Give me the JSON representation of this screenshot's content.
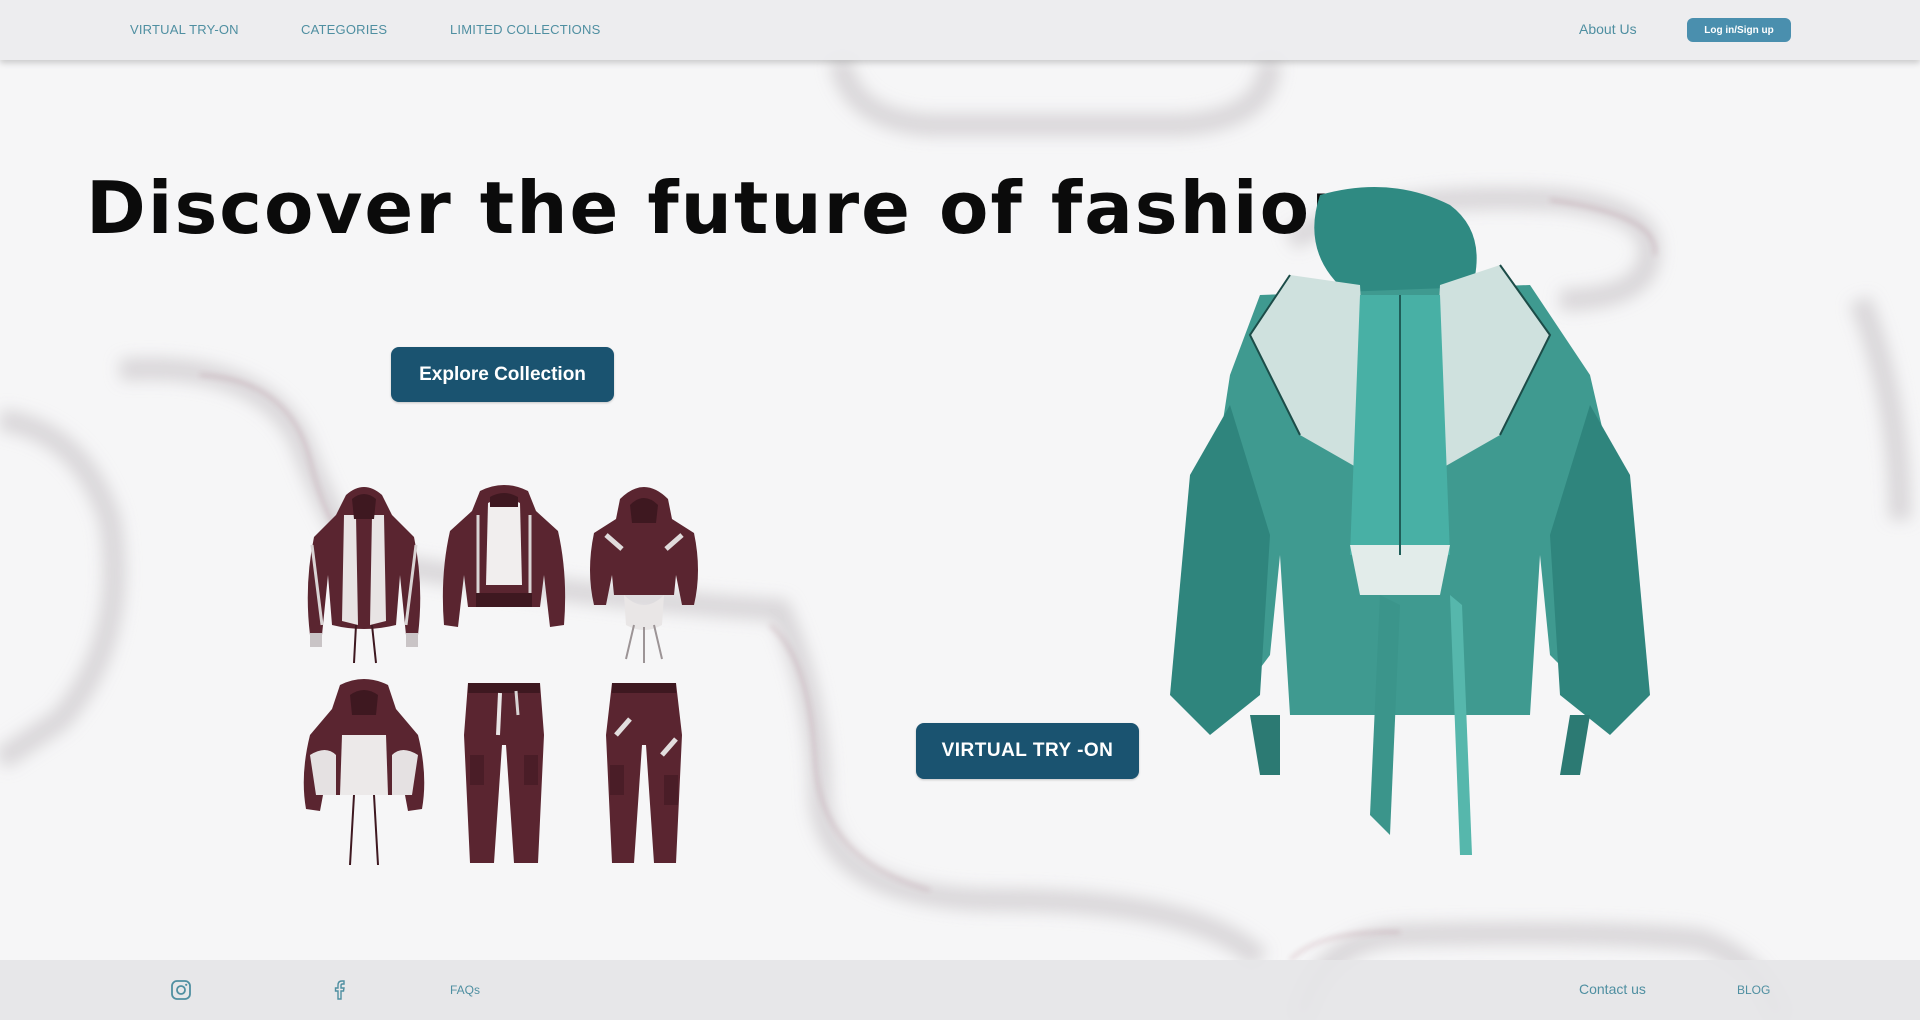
{
  "nav": {
    "left_links": [
      "VIRTUAL TRY-ON",
      "CATEGORIES",
      "LIMITED COLLECTIONS"
    ],
    "about": "About Us",
    "login": "Log in/Sign up"
  },
  "hero": {
    "title": "Discover the future of fashion",
    "explore_button": "Explore Collection",
    "tryon_button": "VIRTUAL TRY -ON"
  },
  "products": [
    {
      "icon": "maroon-hooded-jacket-icon"
    },
    {
      "icon": "maroon-bomber-jacket-icon"
    },
    {
      "icon": "maroon-cropped-hoodie-icon"
    },
    {
      "icon": "maroon-puffer-jacket-icon"
    },
    {
      "icon": "maroon-cargo-pants-icon"
    },
    {
      "icon": "maroon-cargo-pants-icon"
    }
  ],
  "hero_product": {
    "icon": "teal-layered-jacket-icon"
  },
  "footer": {
    "icons": [
      "instagram-icon",
      "facebook-icon"
    ],
    "faqs": "FAQs",
    "contact": "Contact us",
    "blog": "BLOG"
  },
  "colors": {
    "accent": "#4f8fa1",
    "button_dark": "#1a5370",
    "button_light": "#4a8fae",
    "maroon": "#5a2530",
    "teal": "#3f9a90"
  }
}
